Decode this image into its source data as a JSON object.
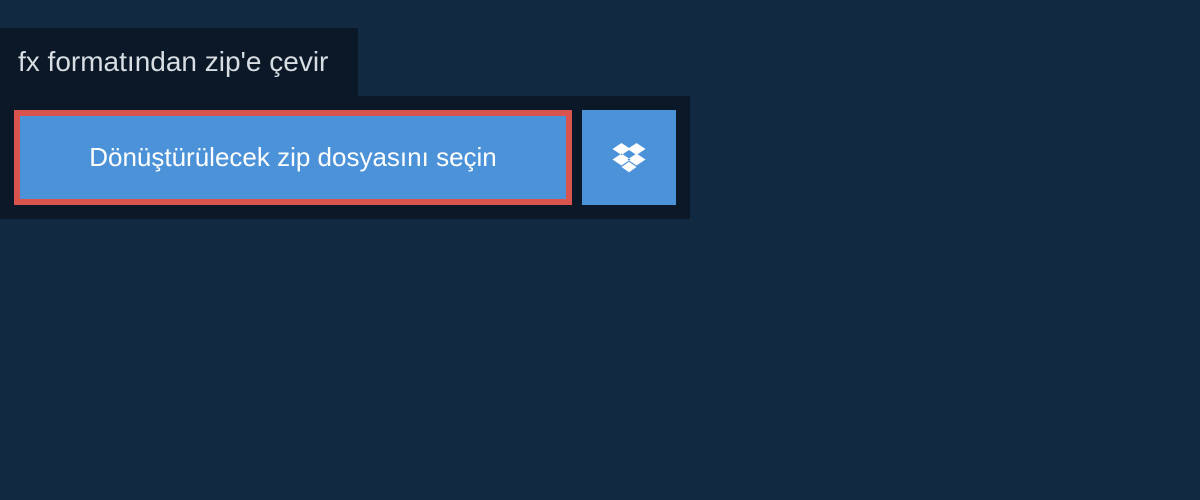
{
  "tab": {
    "title": "fx formatından zip'e çevir"
  },
  "panel": {
    "select_file_label": "Dönüştürülecek zip dosyasını seçin"
  },
  "icons": {
    "dropbox": "dropbox-icon"
  },
  "colors": {
    "background": "#112a42",
    "panel_bg": "#0a1828",
    "button_bg": "#4b92d9",
    "highlight_border": "#d9534f",
    "text": "#ffffff"
  }
}
